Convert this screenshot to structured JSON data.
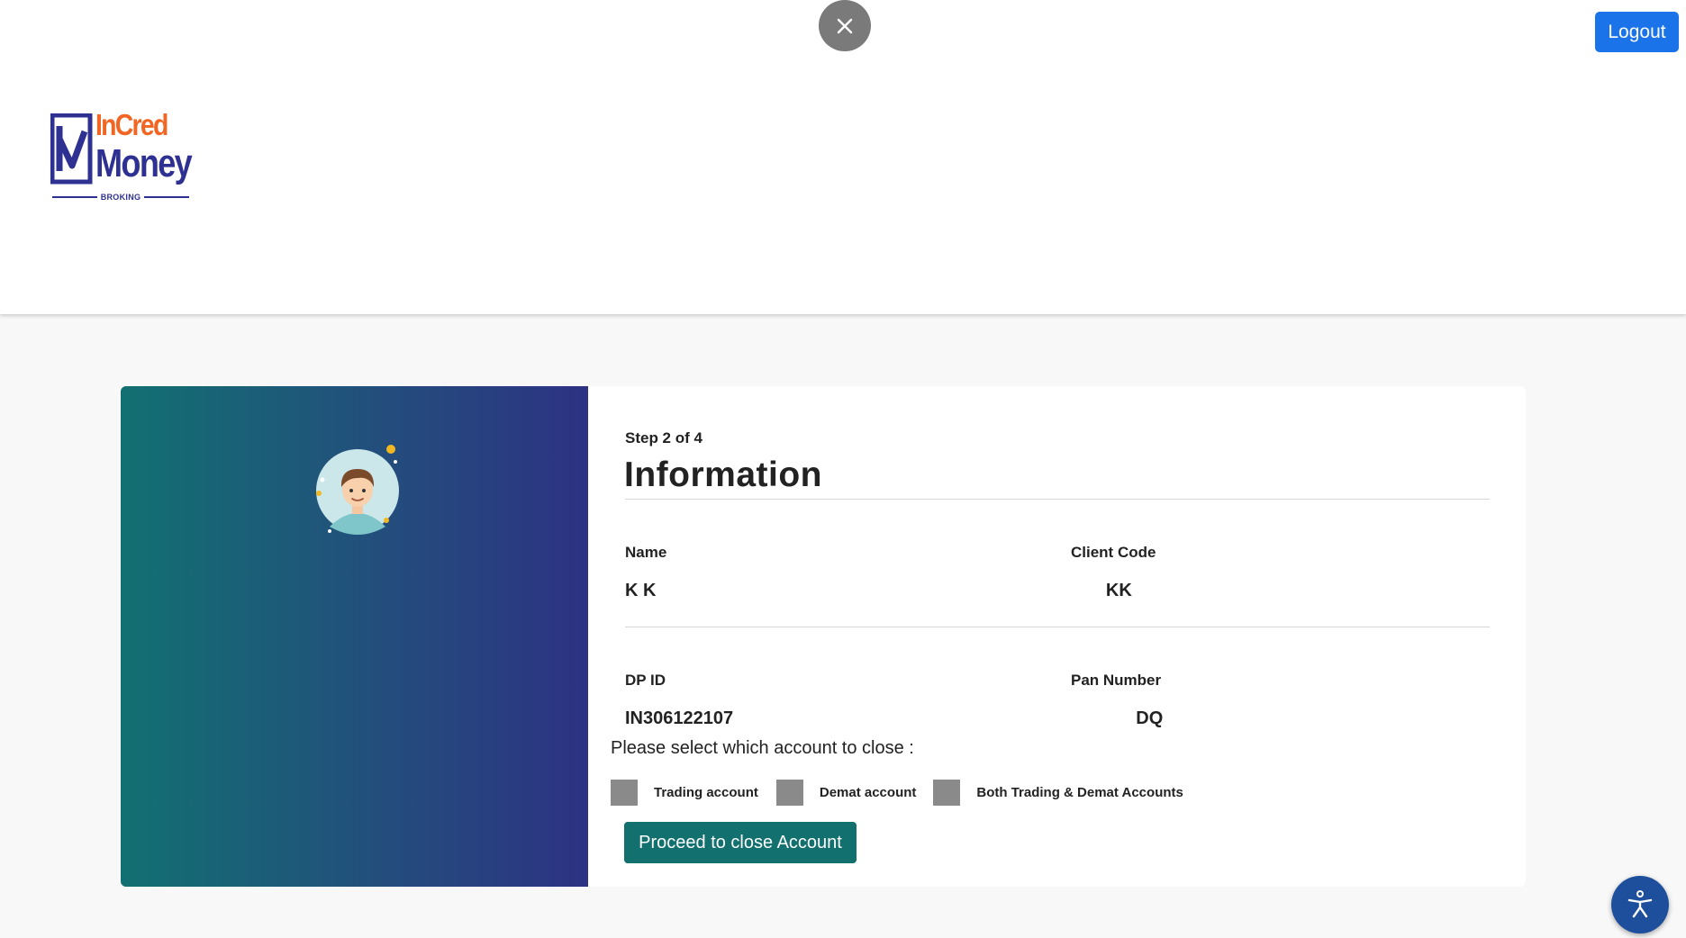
{
  "header": {
    "logout_label": "Logout",
    "logo": {
      "brand_top": "InCred",
      "brand_bottom": "Money",
      "brand_sub": "BROKING"
    }
  },
  "icons": {
    "close": "close-icon",
    "avatar": "user-avatar-icon",
    "accessibility": "accessibility-icon"
  },
  "colors": {
    "logout": "#1a73e8",
    "brand_orange": "#f26522",
    "brand_navy": "#2e3192",
    "panel_gradient_start": "#127072",
    "panel_gradient_end": "#2d3283",
    "proceed": "#12706f",
    "checkbox": "#8a8a8a"
  },
  "form": {
    "step": "Step 2 of 4",
    "title": "Information",
    "fields": {
      "name": {
        "label": "Name",
        "value": "K K"
      },
      "client_code": {
        "label": "Client Code",
        "value": "KK"
      },
      "dp_id": {
        "label": "DP ID",
        "value": "IN306122107"
      },
      "pan_number": {
        "label": "Pan Number",
        "value": "DQ"
      }
    },
    "prompt": "Please select which account to close :",
    "options": [
      {
        "label": "Trading account",
        "checked": false
      },
      {
        "label": "Demat account",
        "checked": false
      },
      {
        "label": "Both Trading & Demat Accounts",
        "checked": false
      }
    ],
    "proceed_label": "Proceed to close Account"
  }
}
